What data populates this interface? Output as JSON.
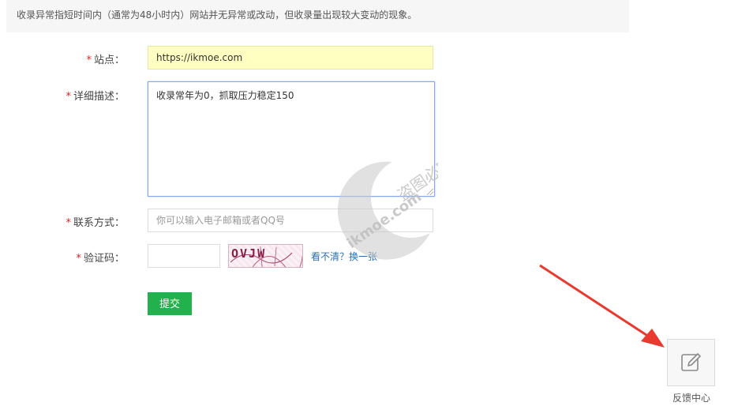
{
  "notice": "收录异常指短时间内（通常为48小时内）网站并无异常或改动，但收录量出现较大变动的现象。",
  "form": {
    "site_label": "站点：",
    "site_value": "https://ikmoe.com",
    "desc_label": "详细描述：",
    "desc_value": "收录常年为0，抓取压力稳定150",
    "contact_label": "联系方式：",
    "contact_placeholder": "你可以输入电子邮箱或者QQ号",
    "captcha_label": "验证码：",
    "captcha_text": "OVJW",
    "refresh_link": "看不清？换一张",
    "required_mark": "*",
    "submit_label": "提交"
  },
  "watermark": {
    "text1": "盗图必究",
    "text2": "ikmoe.com"
  },
  "feedback": {
    "label": "反馈中心",
    "icon": "edit-icon"
  },
  "colors": {
    "accent_green": "#22b14c",
    "required_red": "#e02020",
    "link_blue": "#2a6fb0",
    "arrow_red": "#e83a2f"
  }
}
